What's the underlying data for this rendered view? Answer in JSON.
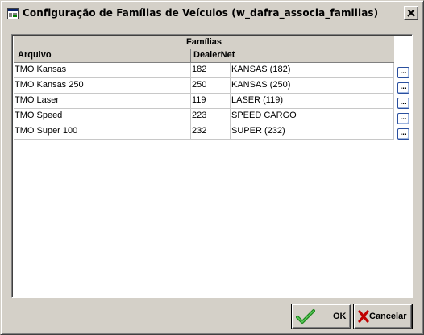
{
  "window": {
    "title": "Configuração de Famílias de Veículos (w_dafra_associa_familias)"
  },
  "grid": {
    "group_header": "Famílias",
    "columns": [
      "Arquivo",
      "DealerNet"
    ],
    "rows": [
      {
        "arquivo": "TMO Kansas",
        "code": "182",
        "name": "KANSAS (182)"
      },
      {
        "arquivo": "TMO Kansas 250",
        "code": "250",
        "name": "KANSAS (250)"
      },
      {
        "arquivo": "TMO Laser",
        "code": "119",
        "name": "LASER (119)"
      },
      {
        "arquivo": "TMO Speed",
        "code": "223",
        "name": "SPEED CARGO"
      },
      {
        "arquivo": "TMO Super 100",
        "code": "232",
        "name": "SUPER (232)"
      }
    ],
    "row_button_label": "..."
  },
  "buttons": {
    "ok_label": "OK",
    "cancel_label": "Cancelar"
  },
  "icons": {
    "title": "app-window-icon",
    "close": "close-icon",
    "ok": "checkmark-icon",
    "cancel": "red-x-icon"
  },
  "colors": {
    "face": "#d4d0c8",
    "ok_check": "#1e8a1e",
    "cancel_x": "#c00000",
    "row_button_border": "#2a4f9e"
  }
}
